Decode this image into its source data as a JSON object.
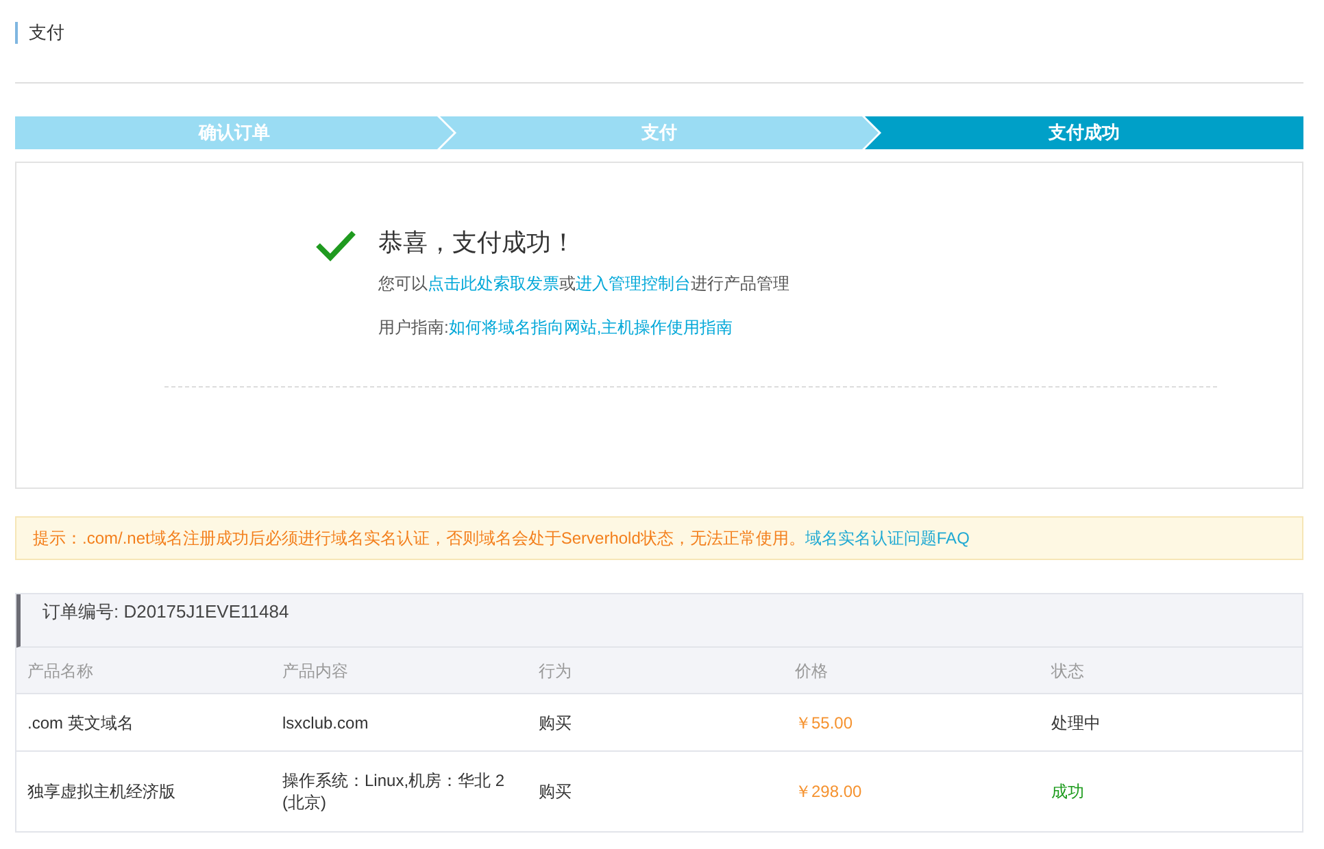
{
  "page_title": "支付",
  "steps": [
    {
      "label": "确认订单",
      "selected": false
    },
    {
      "label": "支付",
      "selected": false
    },
    {
      "label": "支付成功",
      "selected": true
    }
  ],
  "success": {
    "heading": "恭喜，支付成功！",
    "lines": [
      [
        {
          "kind": "text",
          "text": "您可以"
        },
        {
          "kind": "link",
          "text": "点击此处索取发票"
        },
        {
          "kind": "text",
          "text": "或"
        },
        {
          "kind": "link",
          "text": "进入管理控制台"
        },
        {
          "kind": "text",
          "text": "进行产品管理"
        }
      ],
      [
        {
          "kind": "text",
          "text": "用户指南:"
        },
        {
          "kind": "link",
          "text": "如何将域名指向网站,"
        },
        {
          "kind": "link",
          "text": "主机操作使用指南"
        }
      ]
    ]
  },
  "notice": {
    "text": "提示：.com/.net域名注册成功后必须进行域名实名认证，否则域名会处于Serverhold状态，无法正常使用。",
    "link": "域名实名认证问题FAQ"
  },
  "order": {
    "number": "订单编号: D20175J1EVE11484",
    "columns": [
      "产品名称",
      "产品内容",
      "行为",
      "价格",
      "状态"
    ],
    "rows": [
      {
        "name": ".com 英文域名",
        "content": "lsxclub.com",
        "action": "购买",
        "price": "￥55.00",
        "status": "处理中",
        "color": "#333333"
      },
      {
        "name": "独享虚拟主机经济版",
        "content": "操作系统：Linux,机房：华北 2 (北京)",
        "action": "购买",
        "price": "￥298.00",
        "status": "成功",
        "color": "#1a9a1a"
      }
    ]
  }
}
